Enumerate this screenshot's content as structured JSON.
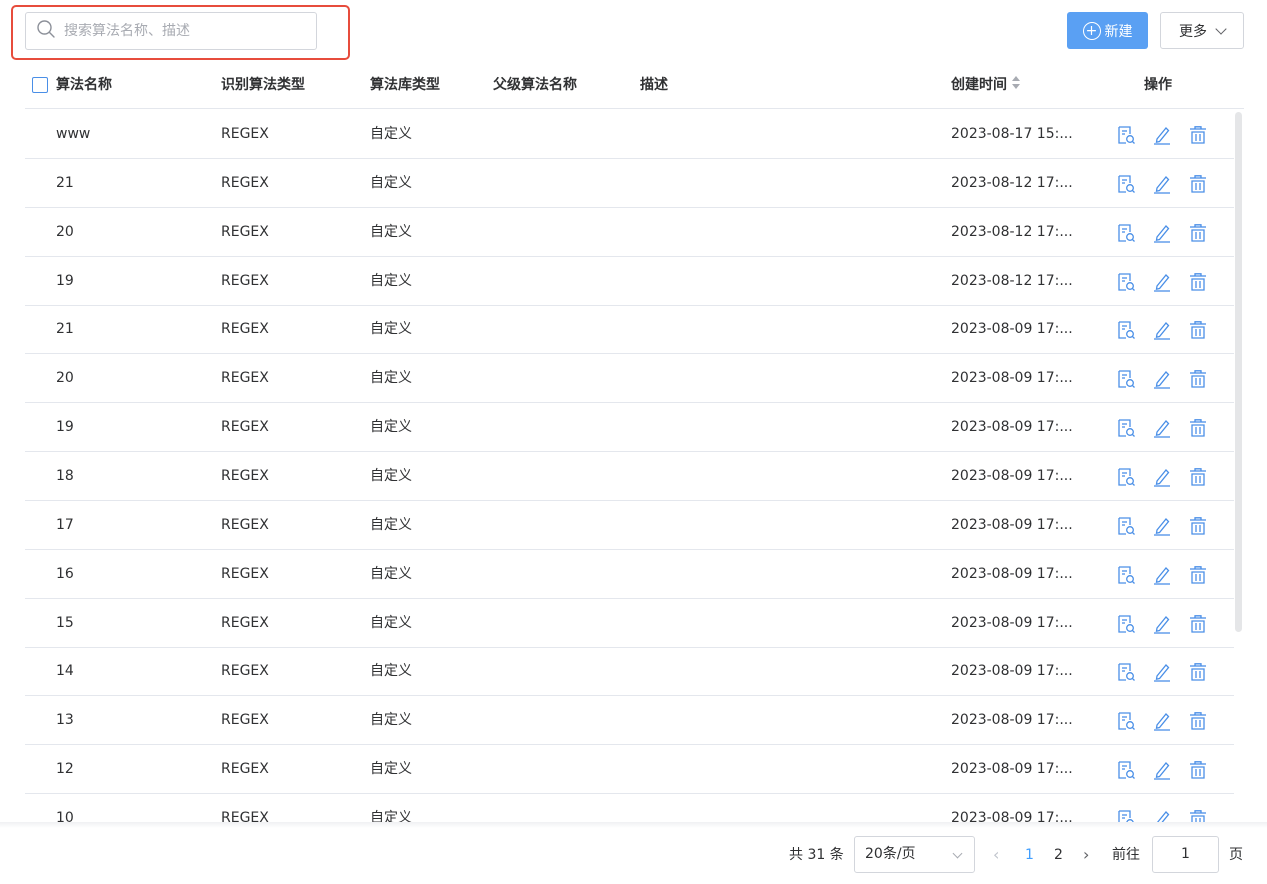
{
  "toolbar": {
    "search_placeholder": "搜索算法名称、描述",
    "new_button_label": "新建",
    "more_button_label": "更多"
  },
  "table": {
    "columns": [
      "算法名称",
      "识别算法类型",
      "算法库类型",
      "父级算法名称",
      "描述",
      "创建时间",
      "操作"
    ],
    "rows": [
      {
        "name": "www",
        "type": "REGEX",
        "lib": "自定义",
        "parent": "",
        "desc": "",
        "created": "2023-08-17 15:..."
      },
      {
        "name": "21",
        "type": "REGEX",
        "lib": "自定义",
        "parent": "",
        "desc": "",
        "created": "2023-08-12 17:..."
      },
      {
        "name": "20",
        "type": "REGEX",
        "lib": "自定义",
        "parent": "",
        "desc": "",
        "created": "2023-08-12 17:..."
      },
      {
        "name": "19",
        "type": "REGEX",
        "lib": "自定义",
        "parent": "",
        "desc": "",
        "created": "2023-08-12 17:..."
      },
      {
        "name": "21",
        "type": "REGEX",
        "lib": "自定义",
        "parent": "",
        "desc": "",
        "created": "2023-08-09 17:..."
      },
      {
        "name": "20",
        "type": "REGEX",
        "lib": "自定义",
        "parent": "",
        "desc": "",
        "created": "2023-08-09 17:..."
      },
      {
        "name": "19",
        "type": "REGEX",
        "lib": "自定义",
        "parent": "",
        "desc": "",
        "created": "2023-08-09 17:..."
      },
      {
        "name": "18",
        "type": "REGEX",
        "lib": "自定义",
        "parent": "",
        "desc": "",
        "created": "2023-08-09 17:..."
      },
      {
        "name": "17",
        "type": "REGEX",
        "lib": "自定义",
        "parent": "",
        "desc": "",
        "created": "2023-08-09 17:..."
      },
      {
        "name": "16",
        "type": "REGEX",
        "lib": "自定义",
        "parent": "",
        "desc": "",
        "created": "2023-08-09 17:..."
      },
      {
        "name": "15",
        "type": "REGEX",
        "lib": "自定义",
        "parent": "",
        "desc": "",
        "created": "2023-08-09 17:..."
      },
      {
        "name": "14",
        "type": "REGEX",
        "lib": "自定义",
        "parent": "",
        "desc": "",
        "created": "2023-08-09 17:..."
      },
      {
        "name": "13",
        "type": "REGEX",
        "lib": "自定义",
        "parent": "",
        "desc": "",
        "created": "2023-08-09 17:..."
      },
      {
        "name": "12",
        "type": "REGEX",
        "lib": "自定义",
        "parent": "",
        "desc": "",
        "created": "2023-08-09 17:..."
      },
      {
        "name": "10",
        "type": "REGEX",
        "lib": "自定义",
        "parent": "",
        "desc": "",
        "created": "2023-08-09 17:..."
      }
    ],
    "row_actions": [
      "view-detail-icon",
      "edit-icon",
      "delete-icon"
    ]
  },
  "pagination": {
    "total_text": "共 31 条",
    "page_size_text": "20条/页",
    "pages": [
      "1",
      "2"
    ],
    "current_page": "1",
    "goto_label": "前往",
    "goto_value": "1",
    "page_suffix": "页"
  },
  "colors": {
    "accent": "#409eff",
    "primary_button": "#5aa0f3",
    "highlight_border": "#e74c3c",
    "border": "#e4e7ed"
  }
}
